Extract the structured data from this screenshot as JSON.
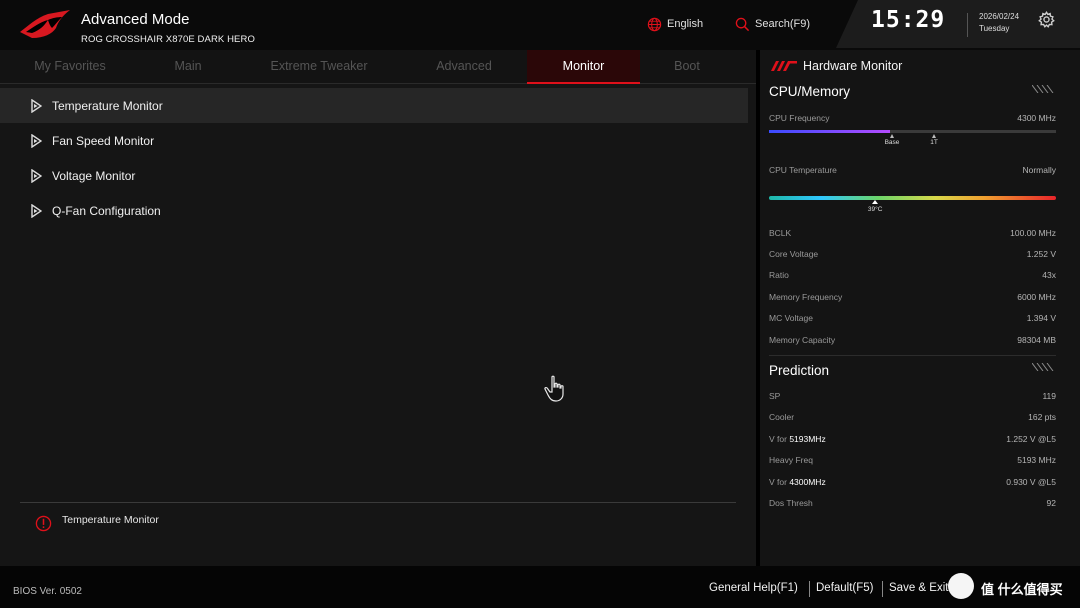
{
  "header": {
    "title": "Advanced Mode",
    "model": "ROG CROSSHAIR X870E DARK HERO",
    "language": "English",
    "search": "Search(F9)",
    "time": "15:29",
    "date": "2026/02/24",
    "day": "Tuesday",
    "icons": {
      "logo": "rog-eye-logo",
      "language": "globe-icon",
      "search": "search-icon",
      "settings": "gear-icon"
    }
  },
  "tabs": [
    {
      "label": "My Favorites"
    },
    {
      "label": "Main"
    },
    {
      "label": "Extreme Tweaker"
    },
    {
      "label": "Advanced"
    },
    {
      "label": "Monitor",
      "active": true
    },
    {
      "label": "Boot"
    }
  ],
  "menu": [
    {
      "label": "Temperature Monitor",
      "selected": true
    },
    {
      "label": "Fan Speed Monitor"
    },
    {
      "label": "Voltage Monitor"
    },
    {
      "label": "Q-Fan Configuration"
    }
  ],
  "help": {
    "text": "Temperature Monitor",
    "icon": "info-icon"
  },
  "hardware_monitor": {
    "title": "Hardware Monitor",
    "cpu_memory": {
      "title": "CPU/Memory",
      "cpu_frequency": {
        "label": "CPU Frequency",
        "value": "4300 MHz",
        "bar_fraction": 0.42,
        "markers": [
          "Base",
          "1T"
        ]
      },
      "cpu_temperature": {
        "label": "CPU Temperature",
        "value": "Normally",
        "reading": "39°C",
        "marker_fraction": 0.37
      },
      "rows": [
        {
          "label": "BCLK",
          "value": "100.00 MHz"
        },
        {
          "label": "Core Voltage",
          "value": "1.252 V"
        },
        {
          "label": "Ratio",
          "value": "43x"
        },
        {
          "label": "Memory Frequency",
          "value": "6000 MHz"
        },
        {
          "label": "MC Voltage",
          "value": "1.394 V"
        },
        {
          "label": "Memory Capacity",
          "value": "98304 MB"
        }
      ]
    },
    "prediction": {
      "title": "Prediction",
      "sp": {
        "label": "SP",
        "value": "119"
      },
      "cooler": {
        "label": "Cooler",
        "value": "162 pts"
      },
      "v1": {
        "prefix": "V for ",
        "freq": "5193MHz",
        "value": "1.252 V @L5"
      },
      "heavy": {
        "label": "Heavy Freq",
        "value": "5193 MHz"
      },
      "v2": {
        "prefix": "V for ",
        "freq": "4300MHz",
        "value": "0.930 V @L5"
      },
      "dos": {
        "label": "Dos Thresh",
        "value": "92"
      }
    }
  },
  "footer": {
    "bios_version": "BIOS Ver. 0502",
    "general_help": "General Help(F1)",
    "default": "Default(F5)",
    "save_exit": "Save & Exit",
    "watermark": "值 什么值得买"
  },
  "colors": {
    "accent": "#e0101a",
    "panel": "#141414",
    "background": "#151515"
  }
}
